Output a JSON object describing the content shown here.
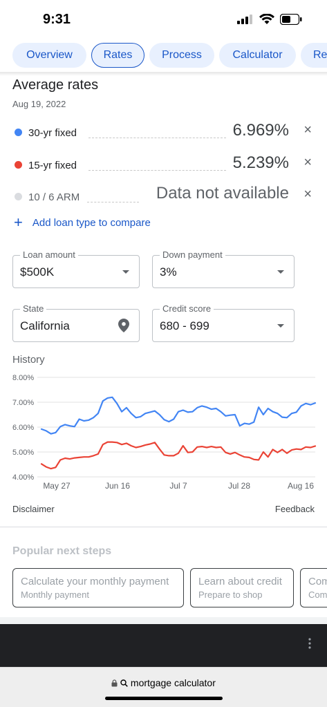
{
  "status": {
    "time": "9:31"
  },
  "tabs": [
    {
      "label": "Overview"
    },
    {
      "label": "Rates"
    },
    {
      "label": "Process"
    },
    {
      "label": "Calculator"
    },
    {
      "label": "Re"
    }
  ],
  "rates": {
    "title": "Average rates",
    "date": "Aug 19, 2022",
    "rows": [
      {
        "label": "30-yr fixed",
        "value": "6.969%",
        "color": "#4285f4"
      },
      {
        "label": "15-yr fixed",
        "value": "5.239%",
        "color": "#ea4335"
      },
      {
        "label": "10 / 6 ARM",
        "value": "Data not available",
        "color": "#dadce0"
      }
    ],
    "close_icon": "×",
    "add_label": "Add loan type to compare"
  },
  "fields": {
    "loan_amount": {
      "label": "Loan amount",
      "value": "$500K"
    },
    "down_payment": {
      "label": "Down payment",
      "value": "3%"
    },
    "state": {
      "label": "State",
      "value": "California"
    },
    "credit_score": {
      "label": "Credit score",
      "value": "680 - 699"
    }
  },
  "history": {
    "label": "History"
  },
  "chart_data": {
    "type": "line",
    "ylim": [
      4.0,
      8.0
    ],
    "y_ticks": [
      "8.00%",
      "7.00%",
      "6.00%",
      "5.00%",
      "4.00%"
    ],
    "x_ticks": [
      "May 27",
      "Jun 16",
      "Jul 7",
      "Jul 28",
      "Aug 16"
    ],
    "grid": true,
    "series": [
      {
        "color": "#4285f4",
        "values": [
          5.92,
          5.85,
          5.73,
          5.78,
          6.02,
          6.1,
          6.05,
          6.02,
          6.32,
          6.25,
          6.28,
          6.38,
          6.55,
          7.05,
          7.17,
          7.2,
          6.95,
          6.62,
          6.78,
          6.55,
          6.38,
          6.42,
          6.55,
          6.6,
          6.65,
          6.5,
          6.3,
          6.22,
          6.32,
          6.62,
          6.68,
          6.6,
          6.62,
          6.78,
          6.85,
          6.8,
          6.72,
          6.75,
          6.62,
          6.45,
          6.48,
          6.5,
          6.05,
          6.15,
          6.12,
          6.2,
          6.8,
          6.5,
          6.75,
          6.62,
          6.55,
          6.4,
          6.38,
          6.55,
          6.6,
          6.85,
          6.95,
          6.9,
          6.969
        ]
      },
      {
        "color": "#ea4335",
        "values": [
          4.52,
          4.4,
          4.33,
          4.38,
          4.68,
          4.75,
          4.72,
          4.76,
          4.78,
          4.8,
          4.8,
          4.85,
          4.92,
          5.3,
          5.4,
          5.4,
          5.38,
          5.3,
          5.35,
          5.25,
          5.18,
          5.22,
          5.28,
          5.32,
          5.38,
          5.12,
          4.88,
          4.85,
          4.85,
          4.95,
          5.25,
          4.98,
          5.0,
          5.2,
          5.22,
          5.18,
          5.22,
          5.18,
          5.2,
          4.98,
          4.92,
          4.98,
          4.88,
          4.8,
          4.78,
          4.7,
          4.68,
          5.0,
          4.8,
          5.1,
          4.98,
          5.1,
          4.95,
          5.08,
          5.12,
          5.1,
          5.2,
          5.18,
          5.239
        ]
      }
    ]
  },
  "footer": {
    "disclaimer": "Disclaimer",
    "feedback": "Feedback"
  },
  "next_steps": {
    "title": "Popular next steps",
    "cards": [
      {
        "title": "Calculate your monthly payment",
        "subtitle": "Monthly payment"
      },
      {
        "title": "Learn about credit",
        "subtitle": "Prepare to shop"
      },
      {
        "title": "Com",
        "subtitle": "Com"
      }
    ]
  },
  "browser": {
    "url": "mortgage calculator"
  }
}
